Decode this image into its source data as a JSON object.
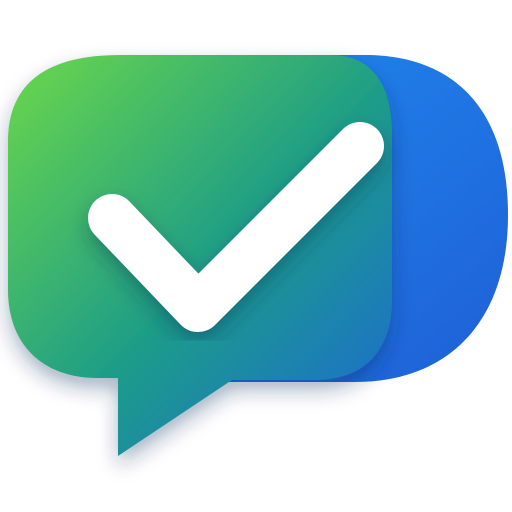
{
  "icon": {
    "name": "chat-check-icon",
    "shape": "speech-bubble-with-checkmark",
    "colors": {
      "gradient_start": "#6bd84a",
      "gradient_mid": "#1f9e86",
      "gradient_end": "#1f67d8",
      "back_layer": "#1b7fe8",
      "checkmark": "#ffffff"
    }
  }
}
